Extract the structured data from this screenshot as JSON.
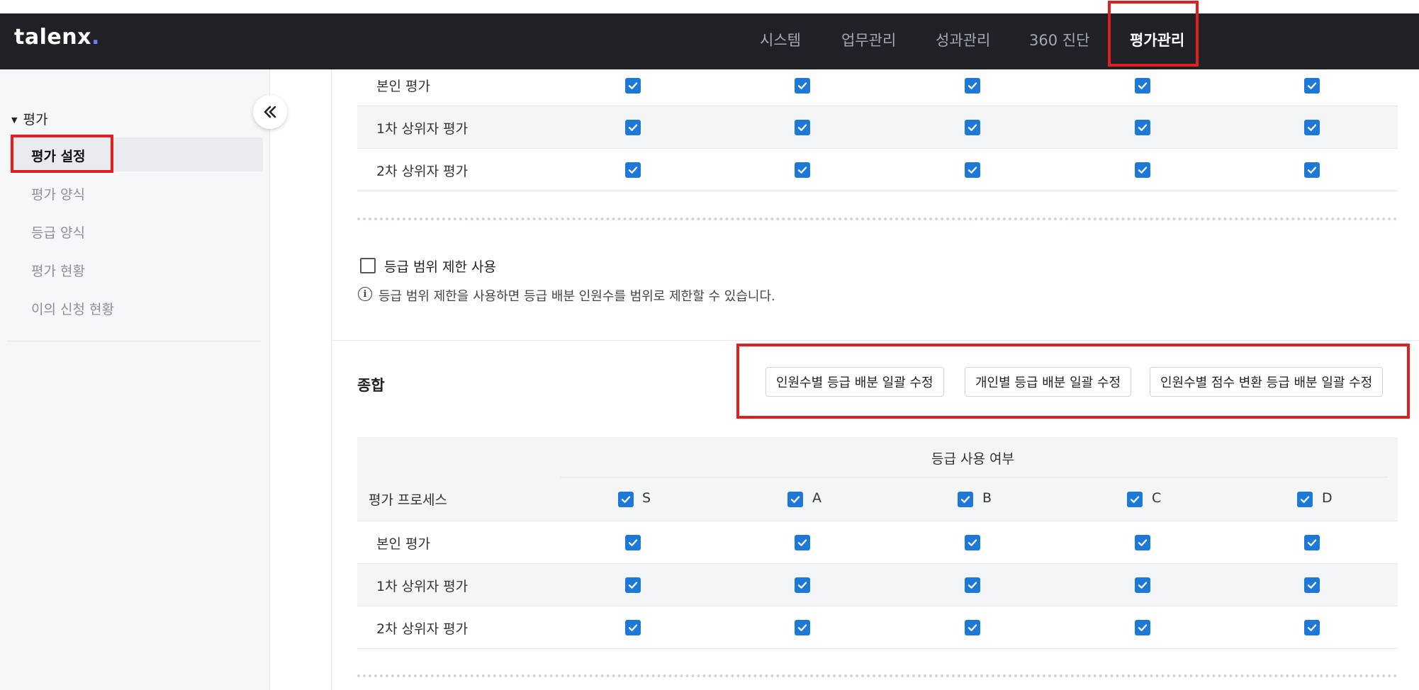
{
  "header": {
    "logo": "talenx",
    "logo_dot": ".",
    "nav": [
      "시스템",
      "업무관리",
      "성과관리",
      "360 진단",
      "평가관리"
    ],
    "active_nav": "평가관리"
  },
  "sidebar": {
    "group": "평가",
    "items": [
      "평가 설정",
      "평가 양식",
      "등급 양식",
      "평가 현황",
      "이의 신청 현황"
    ],
    "active": "평가 설정"
  },
  "top_table": {
    "rows": [
      "본인 평가",
      "1차 상위자 평가",
      "2차 상위자 평가"
    ]
  },
  "grade_range": {
    "label": "등급 범위 제한 사용",
    "checked": false,
    "info": "등급 범위 제한을 사용하면 등급 배분 인원수를 범위로 제한할 수 있습니다."
  },
  "summary": {
    "title": "종합",
    "buttons": [
      "인원수별 등급 배분 일괄 수정",
      "개인별 등급 배분 일괄 수정",
      "인원수별 점수 변환 등급 배분 일괄 수정"
    ]
  },
  "grade_table": {
    "group_header": "등급 사용 여부",
    "process_header": "평가 프로세스",
    "grades": [
      "S",
      "A",
      "B",
      "C",
      "D"
    ],
    "rows": [
      "본인 평가",
      "1차 상위자 평가",
      "2차 상위자 평가"
    ]
  },
  "colors": {
    "header_bg": "#1f2126",
    "checkbox": "#1e78d8",
    "highlight": "#e02020"
  }
}
